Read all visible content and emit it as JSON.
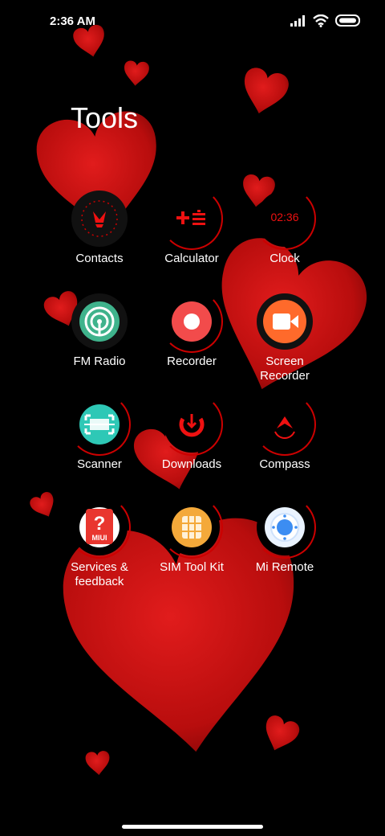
{
  "status_bar": {
    "time": "2:36 AM",
    "icons": [
      "signal-icon",
      "wifi-icon",
      "battery-icon"
    ]
  },
  "folder": {
    "title": "Tools"
  },
  "apps": [
    {
      "label": "Contacts",
      "icon": "contacts-icon"
    },
    {
      "label": "Calculator",
      "icon": "calculator-icon"
    },
    {
      "label": "Clock",
      "icon": "clock-icon",
      "icon_text": "02:36"
    },
    {
      "label": "FM Radio",
      "icon": "fm-radio-icon"
    },
    {
      "label": "Recorder",
      "icon": "recorder-icon"
    },
    {
      "label": "Screen\nRecorder",
      "icon": "screen-recorder-icon"
    },
    {
      "label": "Scanner",
      "icon": "scanner-icon"
    },
    {
      "label": "Downloads",
      "icon": "downloads-icon"
    },
    {
      "label": "Compass",
      "icon": "compass-icon"
    },
    {
      "label": "Services &\nfeedback",
      "icon": "services-feedback-icon",
      "icon_text": "MIUI"
    },
    {
      "label": "SIM Tool Kit",
      "icon": "sim-tool-kit-icon"
    },
    {
      "label": "Mi Remote",
      "icon": "mi-remote-icon"
    }
  ],
  "colors": {
    "accent_red": "#d4141a",
    "background": "#000000"
  }
}
